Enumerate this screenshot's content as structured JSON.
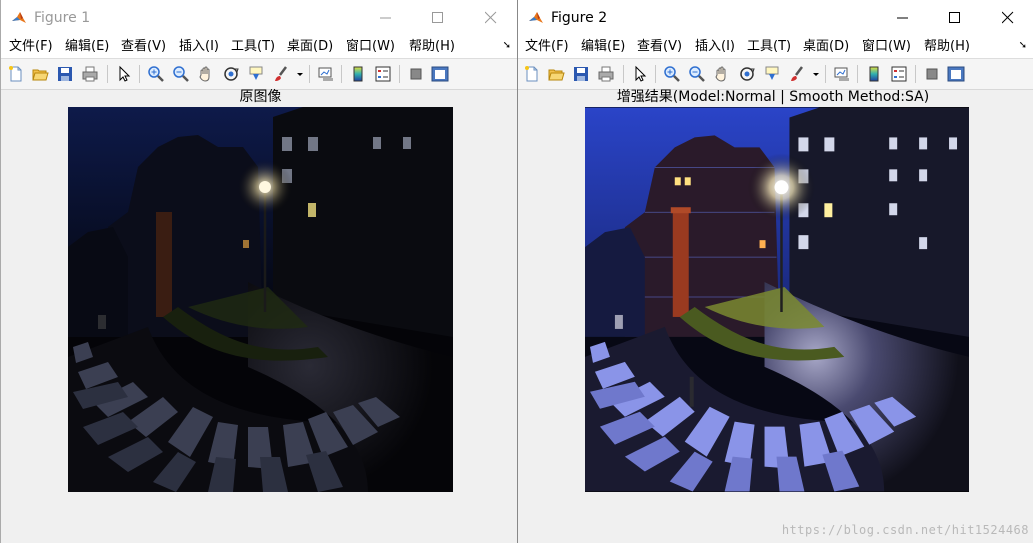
{
  "figures": [
    {
      "title": "Figure 1",
      "plot_title": "原图像",
      "active": false,
      "menus": [
        "文件(F)",
        "编辑(E)",
        "查看(V)",
        "插入(I)",
        "工具(T)",
        "桌面(D)",
        "窗口(W)",
        "帮助(H)"
      ]
    },
    {
      "title": "Figure 2",
      "plot_title": "增强结果(Model:Normal | Smooth Method:SA)",
      "active": true,
      "menus": [
        "文件(F)",
        "编辑(E)",
        "查看(V)",
        "插入(I)",
        "工具(T)",
        "桌面(D)",
        "窗口(W)",
        "帮助(H)"
      ]
    }
  ],
  "toolbar_icons": [
    "new-figure-icon",
    "open-file-icon",
    "save-icon",
    "print-icon",
    "select-arrow-icon",
    "zoom-in-icon",
    "zoom-out-icon",
    "pan-hand-icon",
    "rotate-3d-icon",
    "data-cursor-icon",
    "brush-icon",
    "dropdown-arrow-icon",
    "link-plot-icon",
    "colorbar-icon",
    "legend-icon",
    "hide-plot-tools-icon",
    "show-plot-tools-icon"
  ],
  "watermark": "https://blog.csdn.net/hit1524468",
  "colors": {
    "matlab_orange": "#e8761a",
    "sky_original": "#0f1a45",
    "sky_enhanced": "#2a44c8"
  }
}
